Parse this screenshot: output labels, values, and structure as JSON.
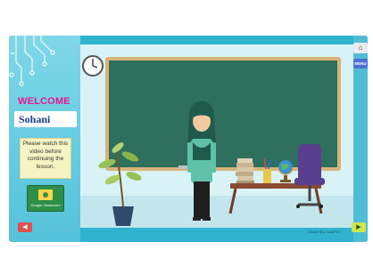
{
  "sidebar": {
    "welcome": "WELCOME",
    "student_name": "Sohani",
    "notice": "Please watch this video before continuing the lesson.",
    "classroom_button_label": "Google Classroom"
  },
  "nav": {
    "home_icon": "home-icon",
    "menu_label": "MENU",
    "prev_icon": "arrow-left-icon",
    "next_icon": "arrow-right-icon"
  },
  "footer": {
    "credit": "GAMIFIED SAMPLE"
  },
  "colors": {
    "accent": "#e5178f",
    "frame": "#2fb3cf",
    "board": "#2f6f5e",
    "menu": "#4b6ed8",
    "next": "#cde64c"
  }
}
